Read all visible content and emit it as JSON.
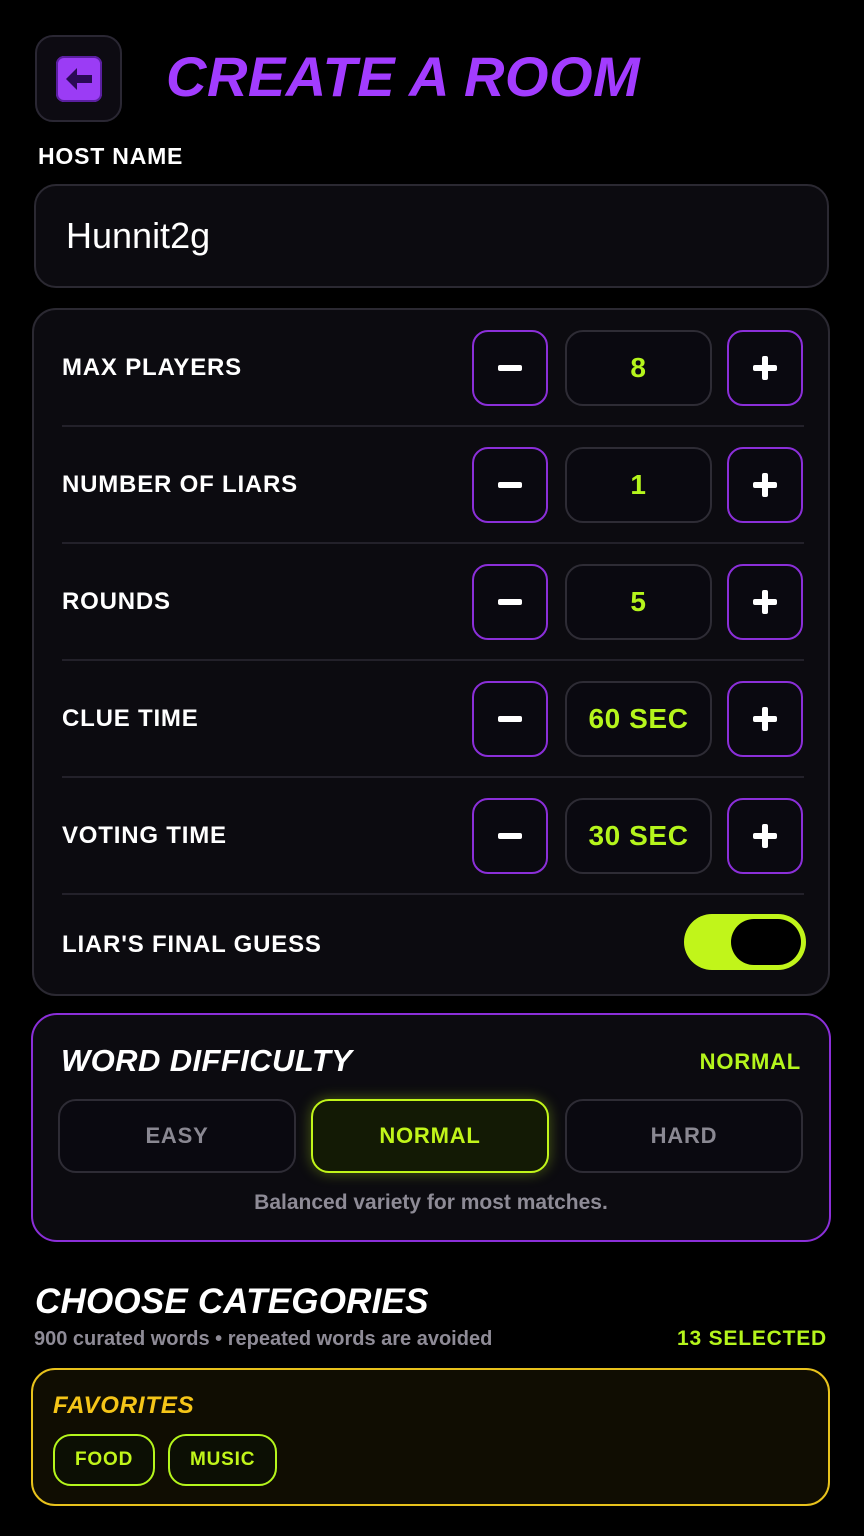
{
  "header": {
    "title": "CREATE A ROOM"
  },
  "host": {
    "label": "HOST NAME",
    "value": "Hunnit2g"
  },
  "settings": {
    "max_players": {
      "label": "MAX PLAYERS",
      "value": "8"
    },
    "liars": {
      "label": "NUMBER OF LIARS",
      "value": "1"
    },
    "rounds": {
      "label": "ROUNDS",
      "value": "5"
    },
    "clue_time": {
      "label": "CLUE TIME",
      "value": "60 SEC"
    },
    "voting_time": {
      "label": "VOTING TIME",
      "value": "30 SEC"
    },
    "final_guess": {
      "label": "LIAR'S FINAL GUESS",
      "enabled": true
    }
  },
  "difficulty": {
    "title": "WORD DIFFICULTY",
    "current": "NORMAL",
    "options": [
      "EASY",
      "NORMAL",
      "HARD"
    ],
    "description": "Balanced variety for most matches."
  },
  "categories": {
    "title": "CHOOSE CATEGORIES",
    "subtitle": "900 curated words • repeated words are avoided",
    "selected_count": "13 SELECTED",
    "favorites": {
      "title": "FAVORITES",
      "chips": [
        "FOOD",
        "MUSIC"
      ]
    }
  },
  "colors": {
    "accent_purple": "#a23cff",
    "accent_lime": "#c1f51a",
    "favorites_gold": "#f5c518"
  },
  "icons": {
    "back": "back-arrow-icon",
    "minus": "minus-icon",
    "plus": "plus-icon"
  }
}
